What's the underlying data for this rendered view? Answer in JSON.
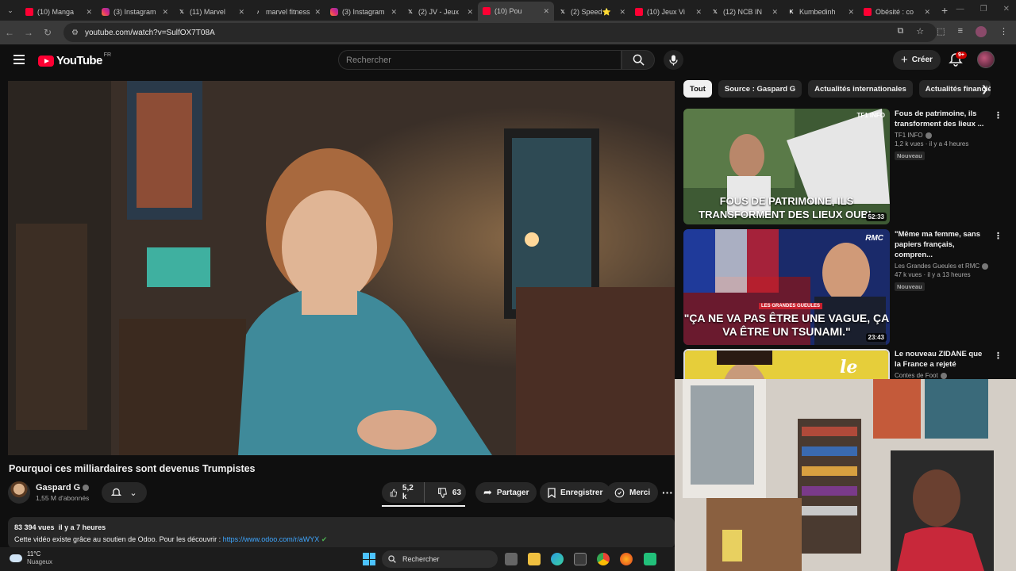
{
  "browser": {
    "tabs": [
      {
        "label": "(10) Manga",
        "icon": "youtube-icon"
      },
      {
        "label": "(3) Instagram",
        "icon": "instagram-icon"
      },
      {
        "label": "(11) Marvel",
        "icon": "x-icon"
      },
      {
        "label": "marvel fitness",
        "icon": "tiktok-icon"
      },
      {
        "label": "(3) Instagram",
        "icon": "instagram-icon"
      },
      {
        "label": "(2) JV - Jeux",
        "icon": "x-icon"
      },
      {
        "label": "(10) Pou",
        "icon": "youtube-icon",
        "active": true
      },
      {
        "label": "(2) Speed⭐",
        "icon": "x-icon"
      },
      {
        "label": "(10) Jeux Vi",
        "icon": "youtube-icon"
      },
      {
        "label": "(12) NCB IN",
        "icon": "x-icon"
      },
      {
        "label": "Kumbedinh",
        "icon": "kumbedinh-icon"
      },
      {
        "label": "Obésité : co",
        "icon": "youtube-icon"
      }
    ],
    "url": "youtube.com/watch?v=SulfOX7T08A"
  },
  "header": {
    "logo_text": "YouTube",
    "region": "FR",
    "search_placeholder": "Rechercher",
    "create_label": "Créer",
    "notif_count": "9+"
  },
  "video": {
    "title": "Pourquoi ces milliardaires sont devenus Trumpistes",
    "channel": "Gaspard G",
    "subscribers": "1,55 M d'abonnés",
    "likes": "5,2 k",
    "dislikes": "63",
    "share_label": "Partager",
    "save_label": "Enregistrer",
    "thanks_label": "Merci",
    "views": "83 394 vues",
    "age": "il y a 7 heures",
    "desc_text": "Cette vidéo existe grâce au soutien de Odoo. Pour les découvrir :",
    "desc_link": "https://www.odoo.com/r/aWYX"
  },
  "chips": [
    "Tout",
    "Source : Gaspard G",
    "Actualités internationales",
    "Actualités financiè"
  ],
  "recommendations": [
    {
      "title": "Fous de patrimoine, ils transforment des lieux ...",
      "channel": "TF1 INFO",
      "meta": "1,2 k vues · il y a 4 heures",
      "badge": "Nouveau",
      "duration": "52:33",
      "thumb_text": "FOUS DE PATRIMOINE, ILS TRANSFORMENT DES LIEUX OUBL",
      "thumb_logo": "TF1 INFO"
    },
    {
      "title": "\"Même ma femme, sans papiers français, compren...",
      "channel": "Les Grandes Gueules et RMC",
      "meta": "47 k vues · il y a 13 heures",
      "badge": "Nouveau",
      "duration": "23:43",
      "thumb_text": "\"ÇA NE VA PAS ÊTRE UNE VAGUE, ÇA VA ÊTRE UN TSUNAMI.\"",
      "thumb_logo": "RMC",
      "thumb_tag": "LES GRANDES GUEULES"
    },
    {
      "title": "Le nouveau ZIDANE que la France a rejeté",
      "channel": "Contes de Foot",
      "thumb_text": "le"
    }
  ],
  "taskbar": {
    "temperature": "11°C",
    "condition": "Nuageux",
    "search_label": "Rechercher"
  },
  "colors": {
    "youtube_red": "#ff0033",
    "link_blue": "#3ea6ff"
  }
}
